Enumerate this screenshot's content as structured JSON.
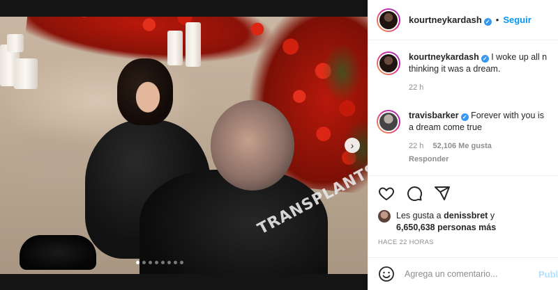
{
  "post": {
    "jacket_text": "TRANSPLANTS",
    "carousel": {
      "slide_count": 8,
      "active_index": 0
    }
  },
  "header": {
    "username": "kourtneykardash",
    "bullet": "•",
    "follow_label": "Seguir"
  },
  "caption": {
    "username": "kourtneykardash",
    "text_line1": "I woke up all n",
    "text_line2": "thinking it was a dream.",
    "time": "22 h"
  },
  "comments": [
    {
      "username": "travisbarker",
      "text_line1": "Forever with you is",
      "text_line2": "a dream come true",
      "time": "22 h",
      "likes": "52,106 Me gusta",
      "reply_label": "Responder"
    }
  ],
  "likes": {
    "prefix": "Les gusta a",
    "user": "denissbret",
    "joiner": "y",
    "count_line": "6,650,638 personas más"
  },
  "time_ago": "HACE 22 HORAS",
  "comment_box": {
    "placeholder": "Agrega un comentario...",
    "publish_label": "Publ"
  },
  "icons": {
    "verified": "verified-icon",
    "heart": "heart-icon",
    "comment": "comment-icon",
    "share": "share-icon",
    "emoji": "emoji-icon",
    "next": "chevron-right-icon"
  },
  "colors": {
    "accent": "#0095f6",
    "verified": "#3897f0",
    "muted": "#8e8e8e",
    "publish_disabled": "#b2dffc"
  }
}
